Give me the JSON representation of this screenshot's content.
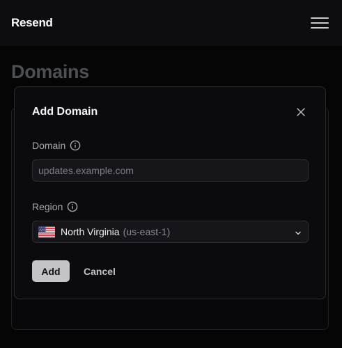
{
  "app": {
    "name": "Resend"
  },
  "page": {
    "title": "Domains"
  },
  "modal": {
    "title": "Add Domain",
    "domain_label": "Domain",
    "domain_placeholder": "updates.example.com",
    "domain_value": "",
    "region_label": "Region",
    "region_selected": "North Virginia",
    "region_code": "(us-east-1)",
    "region_flag": "us-flag",
    "add_label": "Add",
    "cancel_label": "Cancel"
  },
  "icons": {
    "menu": "hamburger-menu-icon",
    "close": "close-icon",
    "info": "info-icon",
    "chevron": "chevron-down-icon"
  },
  "colors": {
    "background": "#050506",
    "topbar": "#0d0d10",
    "modal_bg": "#0b0b0e",
    "input_bg": "#16161a",
    "primary_button": "#c4c4c8"
  }
}
